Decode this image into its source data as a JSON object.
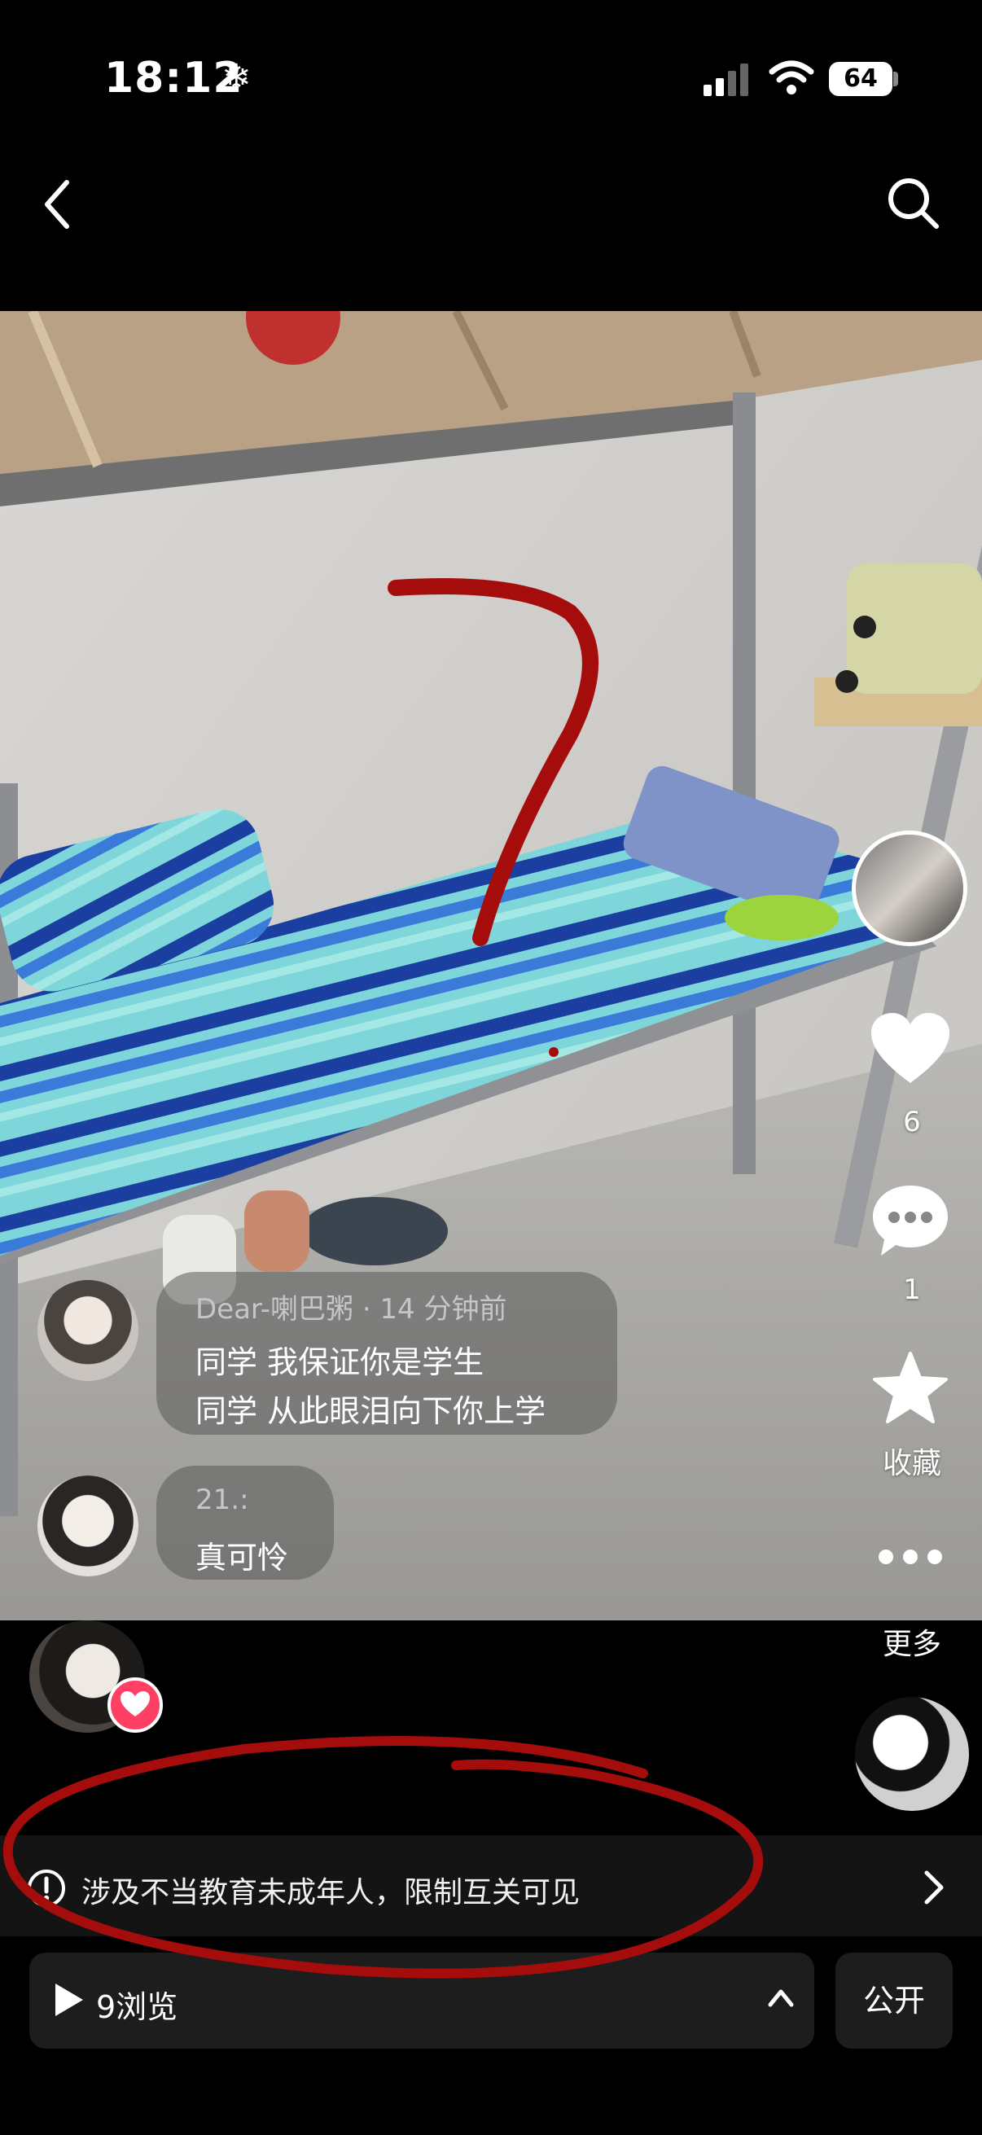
{
  "status_bar": {
    "time": "18:12",
    "weather_icon": "snowflake-icon",
    "battery": "64"
  },
  "nav": {
    "back_icon": "chevron-left-icon",
    "search_icon": "search-icon"
  },
  "actions": {
    "likes": "6",
    "comments": "1",
    "favorite_label": "收藏",
    "more_label": "更多"
  },
  "comments": [
    {
      "name": "Dear-喇巴粥 · 14 分钟前",
      "lines": [
        "同学 我保证你是学生",
        "同学 从此眼泪向下你上学"
      ]
    },
    {
      "name": "21.:",
      "lines": [
        "真可怜"
      ]
    }
  ],
  "notice": {
    "text": "涉及不当教育未成年人，限制互关可见"
  },
  "footer": {
    "views": "9浏览",
    "visibility": "公开"
  },
  "colors": {
    "accent_red": "#ff3f64",
    "annotation_red": "#a50d0d"
  }
}
